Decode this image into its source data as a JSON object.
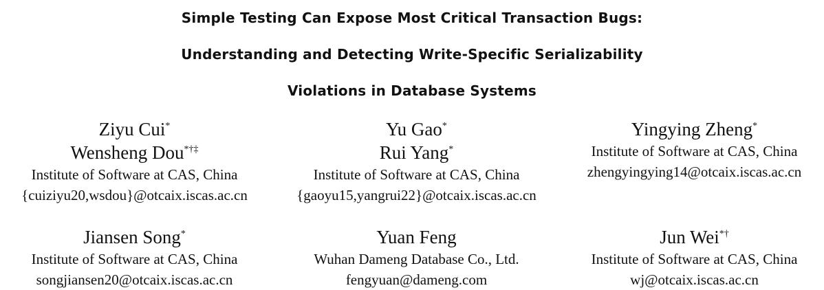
{
  "title": {
    "line1": "Simple Testing Can Expose Most Critical Transaction Bugs:",
    "line2": "Understanding and Detecting Write-Specific Serializability",
    "line3": "Violations in Database Systems"
  },
  "authors": {
    "block1": {
      "name1": "Ziyu Cui",
      "name1_marks": "*",
      "name2": "Wensheng Dou",
      "name2_marks": "*†‡",
      "affiliation": "Institute of Software at CAS, China",
      "email": "{cuiziyu20,wsdou}@otcaix.iscas.ac.cn"
    },
    "block2": {
      "name1": "Yu Gao",
      "name1_marks": "*",
      "name2": "Rui Yang",
      "name2_marks": "*",
      "affiliation": "Institute of Software at CAS, China",
      "email": "{gaoyu15,yangrui22}@otcaix.iscas.ac.cn"
    },
    "block3": {
      "name1": "Yingying Zheng",
      "name1_marks": "*",
      "affiliation": "Institute of Software at CAS, China",
      "email": "zhengyingying14@otcaix.iscas.ac.cn"
    },
    "block4": {
      "name1": "Jiansen Song",
      "name1_marks": "*",
      "affiliation": "Institute of Software at CAS, China",
      "email": "songjiansen20@otcaix.iscas.ac.cn"
    },
    "block5": {
      "name1": "Yuan Feng",
      "affiliation": "Wuhan Dameng Database Co., Ltd.",
      "email": "fengyuan@dameng.com"
    },
    "block6": {
      "name1": "Jun Wei",
      "name1_marks": "*†",
      "affiliation": "Institute of Software at CAS, China",
      "email": "wj@otcaix.iscas.ac.cn"
    }
  }
}
